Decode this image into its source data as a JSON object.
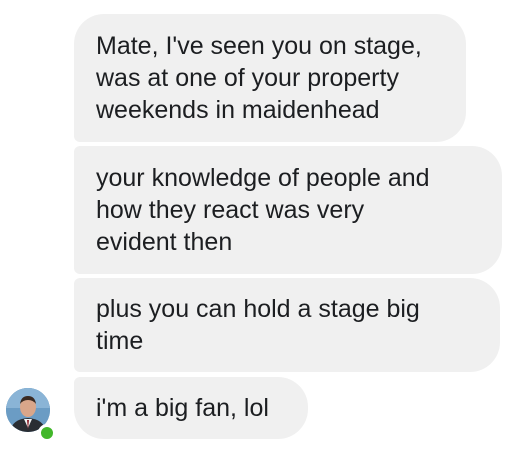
{
  "conversation": {
    "messages": [
      {
        "text": "Mate, I've seen you on stage,\nwas at one of your property\nweekends in maidenhead"
      },
      {
        "text": "your knowledge of people and\nhow they react was very\nevident then"
      },
      {
        "text": "plus you can hold a stage big\ntime"
      },
      {
        "text": "i'm a big fan, lol"
      }
    ],
    "sender": {
      "avatar_icon": "person-photo-icon",
      "status": "online",
      "status_color": "#42b72a"
    },
    "bubble_color": "#f0f0f0"
  }
}
